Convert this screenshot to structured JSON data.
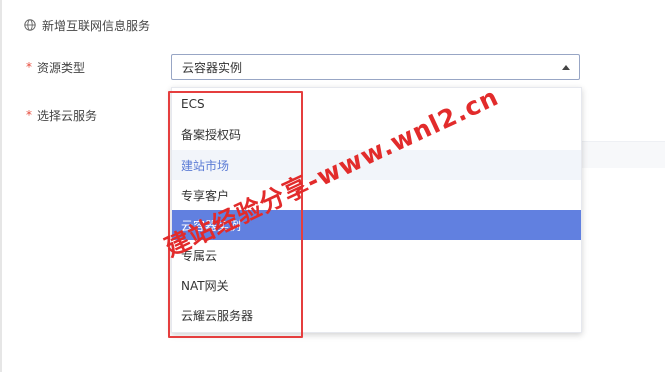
{
  "section": {
    "title": "新增互联网信息服务",
    "icon": "globe-icon"
  },
  "form": {
    "required_mark": "*",
    "resource_type_label": "资源类型",
    "cloud_service_label": "选择云服务",
    "resource_type_value": "云容器实例"
  },
  "dropdown": {
    "options": [
      "ECS",
      "备案授权码",
      "建站市场",
      "专享客户",
      "云容器实例",
      "专属云",
      "NAT网关",
      "云耀云服务器"
    ],
    "hover_index": 2,
    "selected_index": 4
  },
  "watermark": {
    "text": "建站经验分享-www.wnl2.cn"
  },
  "colors": {
    "accent": "#6180e0",
    "highlight": "#e53e3e",
    "required": "#e74b3c"
  }
}
